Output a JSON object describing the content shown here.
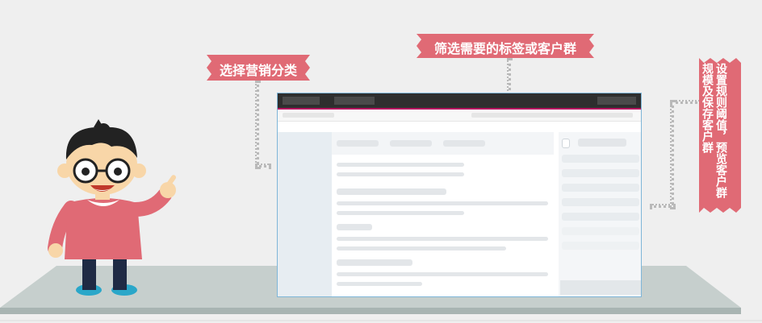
{
  "callouts": {
    "category": "选择营销分类",
    "filter": "筛选需要的标签或客户群",
    "preview": "设置规则阈值，预览客户群规模及保存客户群"
  },
  "colors": {
    "banner": "#e06a75",
    "floor": "#c6cfcd",
    "floor_edge": "#a8b4b2",
    "window_border": "#7fb6d8",
    "topbar": "#2e2e2e",
    "topbar_accent": "#b5145f"
  },
  "character": {
    "icon": "cartoon-man-pointing"
  }
}
